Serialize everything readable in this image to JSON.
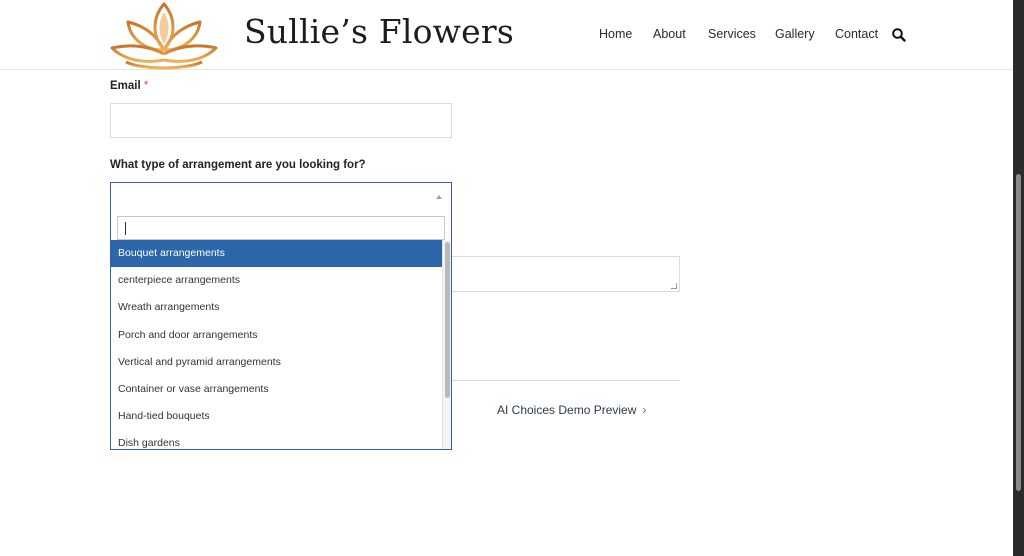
{
  "site": {
    "title": "Sullie’s Flowers"
  },
  "nav": {
    "items": [
      "Home",
      "About",
      "Services",
      "Gallery",
      "Contact"
    ]
  },
  "form": {
    "email_label": "Email",
    "required_mark": "*",
    "email_value": "",
    "arrangement_label": "What type of arrangement are you looking for?",
    "arrangement_selected": "",
    "search_value": ""
  },
  "dropdown": {
    "options": [
      "Bouquet arrangements",
      "centerpiece arrangements",
      "Wreath arrangements",
      "Porch and door arrangements",
      "Vertical and pyramid arrangements",
      "Container or vase arrangements",
      "Hand-tied bouquets",
      "Dish gardens"
    ],
    "highlighted_index": 0
  },
  "footer_nav": {
    "next_label": "AI Choices Demo Preview",
    "next_icon": "chevron-right-icon"
  },
  "colors": {
    "accent": "#2c66ab",
    "focus_border": "#3b5ba8",
    "required": "#d9534f",
    "logo": "#d4862f"
  }
}
